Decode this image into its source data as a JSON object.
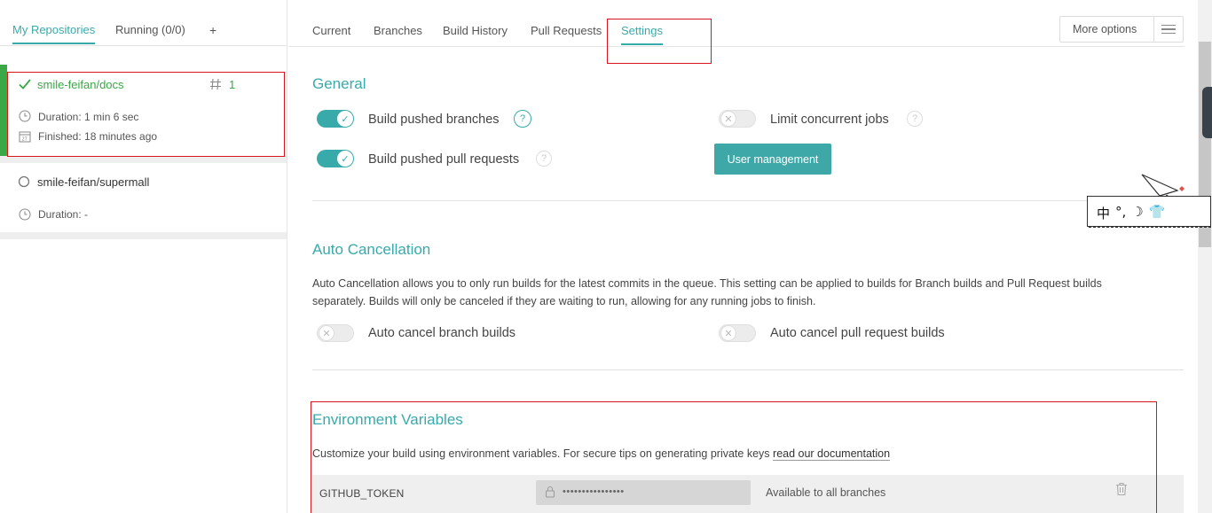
{
  "sidebar": {
    "tabs": [
      {
        "label": "My Repositories"
      },
      {
        "label": "Running (0/0)"
      },
      {
        "label": "+"
      }
    ],
    "repos": [
      {
        "name": "smile-feifan/docs",
        "build_number": "1",
        "duration": "Duration: 1 min 6 sec",
        "finished": "Finished: 18 minutes ago"
      },
      {
        "name": "smile-feifan/supermall",
        "duration": "Duration: -"
      }
    ]
  },
  "tabs": [
    {
      "label": "Current"
    },
    {
      "label": "Branches"
    },
    {
      "label": "Build History"
    },
    {
      "label": "Pull Requests"
    },
    {
      "label": "Settings"
    }
  ],
  "more_options": {
    "label": "More options"
  },
  "general": {
    "title": "General",
    "build_pushed_branches": "Build pushed branches",
    "build_pushed_prs": "Build pushed pull requests",
    "limit_concurrent": "Limit concurrent jobs",
    "user_management": "User management"
  },
  "auto_cancel": {
    "title": "Auto Cancellation",
    "description": "Auto Cancellation allows you to only run builds for the latest commits in the queue. This setting can be applied to builds for Branch builds and Pull Request builds separately. Builds will only be canceled if they are waiting to run, allowing for any running jobs to finish.",
    "branch_label": "Auto cancel branch builds",
    "pr_label": "Auto cancel pull request builds"
  },
  "env": {
    "title": "Environment Variables",
    "description": "Customize your build using environment variables. For secure tips on generating private keys",
    "link": "read our documentation",
    "variables": [
      {
        "name": "GITHUB_TOKEN",
        "value": "••••••••••••••••",
        "branches": "Available to all branches"
      }
    ]
  },
  "ime": {
    "chars": [
      "中",
      "°,",
      "☽",
      "👕"
    ]
  },
  "colors": {
    "accent": "#39aaaa",
    "passed": "#39a845",
    "highlight": "#d9161e"
  }
}
